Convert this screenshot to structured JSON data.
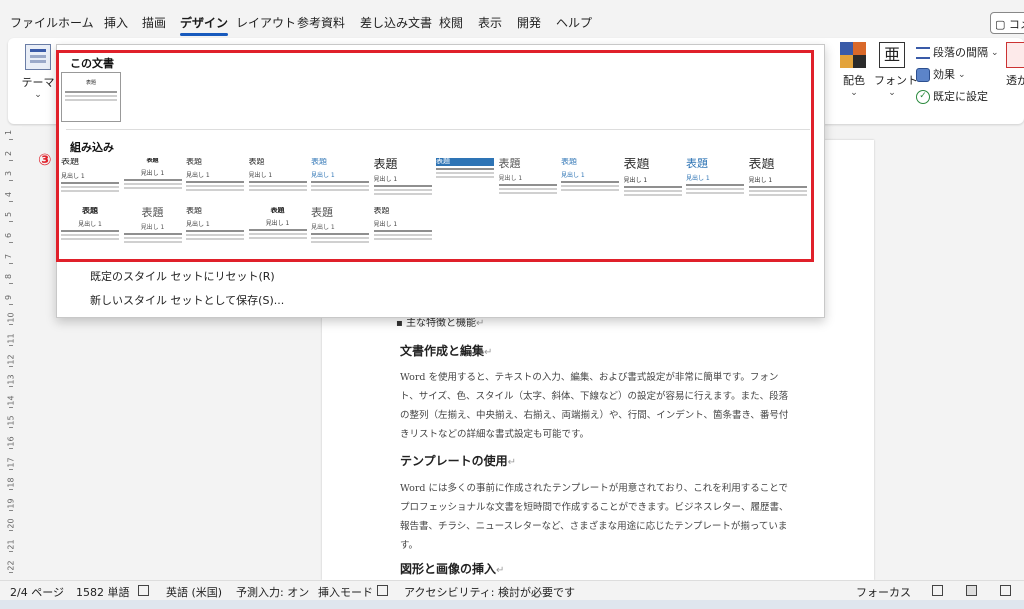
{
  "menu": {
    "tabs": [
      "ファイル",
      "ホーム",
      "挿入",
      "描画",
      "デザイン",
      "レイアウト",
      "参考資料",
      "差し込み文書",
      "校閲",
      "表示",
      "開発",
      "ヘルプ"
    ],
    "active": "デザイン",
    "comment_button": "コメ"
  },
  "ribbon": {
    "theme_label": "テーマ",
    "colors_label": "配色",
    "fonts_label": "フォント",
    "paragraph_spacing_label": "段落の間隔",
    "effects_label": "効果",
    "set_default_label": "既定に設定",
    "watermark_label": "透か"
  },
  "dropdown": {
    "section_this_doc": "この文書",
    "section_builtin": "組み込み",
    "thumb_title": "表題",
    "reset_label": "既定のスタイル セットにリセット(R)",
    "save_label": "新しいスタイル セットとして保存(S)...",
    "annotation": "③",
    "styles": [
      {
        "title": "表題",
        "heading": "見出し 1"
      },
      {
        "title": "表題",
        "heading": "見出し 1"
      },
      {
        "title": "表題",
        "heading": "見出し 1"
      },
      {
        "title": "表題",
        "heading": "見出し 1"
      },
      {
        "title": "表題",
        "heading": "見出し 1"
      },
      {
        "title": "表題",
        "heading": "見出し 1"
      },
      {
        "title": "表題",
        "heading": ""
      },
      {
        "title": "表題",
        "heading": "見出し 1"
      },
      {
        "title": "表題",
        "heading": "見出し 1"
      },
      {
        "title": "表題",
        "heading": "見出し 1"
      },
      {
        "title": "表題",
        "heading": "見出し 1"
      },
      {
        "title": "表題",
        "heading": "見出し 1"
      },
      {
        "title": "表題",
        "heading": "見出し 1"
      },
      {
        "title": "表題",
        "heading": "見出し 1"
      },
      {
        "title": "表題",
        "heading": "見出し 1"
      },
      {
        "title": "表題",
        "heading": "見出し 1"
      },
      {
        "title": "表題",
        "heading": "見出し 1"
      },
      {
        "title": "表題",
        "heading": "見出し 1"
      }
    ]
  },
  "document": {
    "bullet_text": "主な特徴と機能",
    "h1": "文書作成と編集",
    "p1": "Word を使用すると、テキストの入力、編集、および書式設定が非常に簡単です。フォント、サイズ、色、スタイル（太字、斜体、下線など）の設定が容易に行えます。また、段落の整列（左揃え、中央揃え、右揃え、両端揃え）や、行間、インデント、箇条書き、番号付きリストなどの詳細な書式設定も可能です。",
    "h2": "テンプレートの使用",
    "p2": "Word には多くの事前に作成されたテンプレートが用意されており、これを利用することでプロフェッショナルな文書を短時間で作成することができます。ビジネスレター、履歴書、報告書、チラシ、ニュースレターなど、さまざまな用途に応じたテンプレートが揃っています。",
    "h3": "図形と画像の挿入"
  },
  "ruler_numbers": [
    "1",
    "2",
    "3",
    "4",
    "5",
    "6",
    "7",
    "8",
    "9",
    "10",
    "11",
    "12",
    "13",
    "14",
    "15",
    "16",
    "17",
    "18",
    "19",
    "20",
    "21",
    "22"
  ],
  "status": {
    "page": "2/4 ページ",
    "words": "1582 単語",
    "language": "英語 (米国)",
    "predict": "予測入力: オン",
    "insert_mode": "挿入モード",
    "accessibility": "アクセシビリティ: 検討が必要です",
    "focus": "フォーカス"
  },
  "colors": {
    "accent": "#185abd",
    "annotation_red": "#e0202a"
  }
}
